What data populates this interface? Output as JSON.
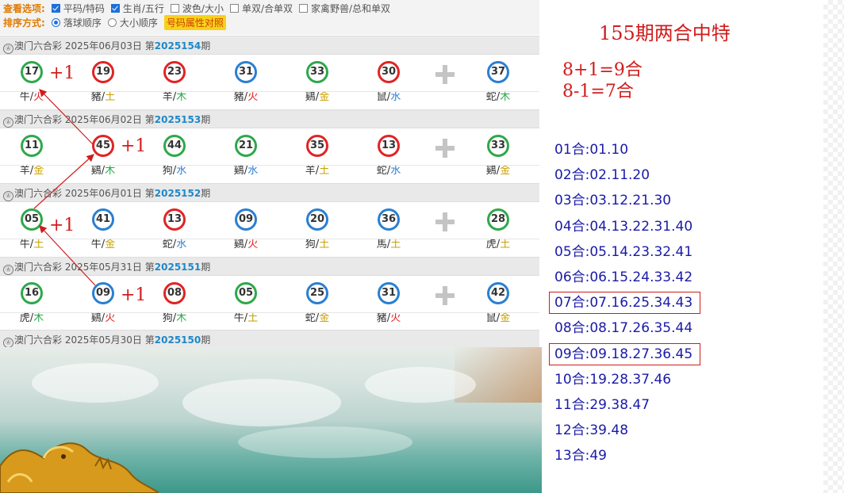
{
  "options": {
    "row1_title": "查看选项:",
    "row1_items": [
      {
        "type": "checkbox",
        "checked": true,
        "label": "平码/特码"
      },
      {
        "type": "checkbox",
        "checked": true,
        "label": "生肖/五行"
      },
      {
        "type": "checkbox",
        "checked": false,
        "label": "波色/大小"
      },
      {
        "type": "checkbox",
        "checked": false,
        "label": "单双/合单双"
      },
      {
        "type": "checkbox",
        "checked": false,
        "label": "家禽野兽/总和单双"
      }
    ],
    "row2_title": "排序方式:",
    "row2_items": [
      {
        "type": "radio",
        "checked": true,
        "label": "落球顺序"
      },
      {
        "type": "radio",
        "checked": false,
        "label": "大小顺序"
      }
    ],
    "attr_button": "号码属性对照"
  },
  "draws": [
    {
      "lottery": "澳门六合彩",
      "date": "2025年06月03日",
      "prefix": "第",
      "issue": "2025154",
      "suffix": "期",
      "balls": [
        {
          "num": "17",
          "color": "green",
          "zodiac": "牛",
          "element": "火"
        },
        {
          "num": "19",
          "color": "red",
          "zodiac": "豬",
          "element": "土"
        },
        {
          "num": "23",
          "color": "red",
          "zodiac": "羊",
          "element": "木"
        },
        {
          "num": "31",
          "color": "blue",
          "zodiac": "豬",
          "element": "火"
        },
        {
          "num": "33",
          "color": "green",
          "zodiac": "鷄",
          "element": "金"
        },
        {
          "num": "30",
          "color": "red",
          "zodiac": "鼠",
          "element": "水"
        }
      ],
      "special": {
        "num": "37",
        "color": "blue",
        "zodiac": "蛇",
        "element": "木"
      }
    },
    {
      "lottery": "澳门六合彩",
      "date": "2025年06月02日",
      "prefix": "第",
      "issue": "2025153",
      "suffix": "期",
      "balls": [
        {
          "num": "11",
          "color": "green",
          "zodiac": "羊",
          "element": "金"
        },
        {
          "num": "45",
          "color": "red",
          "zodiac": "鷄",
          "element": "木"
        },
        {
          "num": "44",
          "color": "green",
          "zodiac": "狗",
          "element": "水"
        },
        {
          "num": "21",
          "color": "green",
          "zodiac": "鷄",
          "element": "水"
        },
        {
          "num": "35",
          "color": "red",
          "zodiac": "羊",
          "element": "土"
        },
        {
          "num": "13",
          "color": "red",
          "zodiac": "蛇",
          "element": "水"
        }
      ],
      "special": {
        "num": "33",
        "color": "green",
        "zodiac": "鷄",
        "element": "金"
      }
    },
    {
      "lottery": "澳门六合彩",
      "date": "2025年06月01日",
      "prefix": "第",
      "issue": "2025152",
      "suffix": "期",
      "balls": [
        {
          "num": "05",
          "color": "green",
          "zodiac": "牛",
          "element": "土"
        },
        {
          "num": "41",
          "color": "blue",
          "zodiac": "牛",
          "element": "金"
        },
        {
          "num": "13",
          "color": "red",
          "zodiac": "蛇",
          "element": "水"
        },
        {
          "num": "09",
          "color": "blue",
          "zodiac": "鷄",
          "element": "火"
        },
        {
          "num": "20",
          "color": "blue",
          "zodiac": "狗",
          "element": "土"
        },
        {
          "num": "36",
          "color": "blue",
          "zodiac": "馬",
          "element": "土"
        }
      ],
      "special": {
        "num": "28",
        "color": "green",
        "zodiac": "虎",
        "element": "土"
      }
    },
    {
      "lottery": "澳门六合彩",
      "date": "2025年05月31日",
      "prefix": "第",
      "issue": "2025151",
      "suffix": "期",
      "balls": [
        {
          "num": "16",
          "color": "green",
          "zodiac": "虎",
          "element": "木"
        },
        {
          "num": "09",
          "color": "blue",
          "zodiac": "鷄",
          "element": "火"
        },
        {
          "num": "08",
          "color": "red",
          "zodiac": "狗",
          "element": "木"
        },
        {
          "num": "05",
          "color": "green",
          "zodiac": "牛",
          "element": "土"
        },
        {
          "num": "25",
          "color": "blue",
          "zodiac": "蛇",
          "element": "金"
        },
        {
          "num": "31",
          "color": "blue",
          "zodiac": "豬",
          "element": "火"
        }
      ],
      "special": {
        "num": "42",
        "color": "blue",
        "zodiac": "鼠",
        "element": "金"
      }
    },
    {
      "lottery": "澳门六合彩",
      "date": "2025年05月30日",
      "prefix": "第",
      "issue": "2025150",
      "suffix": "期",
      "balls": [],
      "special": null
    }
  ],
  "annotations": {
    "plus_one_labels": [
      "+1",
      "+1",
      "+1",
      "+1"
    ]
  },
  "right_panel": {
    "title": "155期两合中特",
    "equations": [
      "8+1=9合",
      "8-1=7合"
    ],
    "he_list": [
      {
        "label": "01合:",
        "nums": "01.10",
        "boxed": false
      },
      {
        "label": "02合:",
        "nums": "02.11.20",
        "boxed": false
      },
      {
        "label": "03合:",
        "nums": "03.12.21.30",
        "boxed": false
      },
      {
        "label": "04合:",
        "nums": "04.13.22.31.40",
        "boxed": false
      },
      {
        "label": "05合:",
        "nums": "05.14.23.32.41",
        "boxed": false
      },
      {
        "label": "06合:",
        "nums": "06.15.24.33.42",
        "boxed": false
      },
      {
        "label": "07合:",
        "nums": "07.16.25.34.43",
        "boxed": true
      },
      {
        "label": "08合:",
        "nums": "08.17.26.35.44",
        "boxed": false
      },
      {
        "label": "09合:",
        "nums": "09.18.27.36.45",
        "boxed": true
      },
      {
        "label": "10合:",
        "nums": "19.28.37.46",
        "boxed": false
      },
      {
        "label": "11合:",
        "nums": "29.38.47",
        "boxed": false
      },
      {
        "label": "12合:",
        "nums": "39.48",
        "boxed": false
      },
      {
        "label": "13合:",
        "nums": "49",
        "boxed": false
      }
    ]
  },
  "colors": {
    "ball_red": "#e02424",
    "ball_green": "#2ea84a",
    "ball_blue": "#2a7fd2",
    "element_fire": "#e02424",
    "element_earth": "#c8a000",
    "element_wood": "#2ea84a",
    "element_water": "#2a7fd2",
    "element_metal": "#c8a000",
    "annotation_red": "#d01c1c",
    "list_blue": "#1a1aa8"
  }
}
